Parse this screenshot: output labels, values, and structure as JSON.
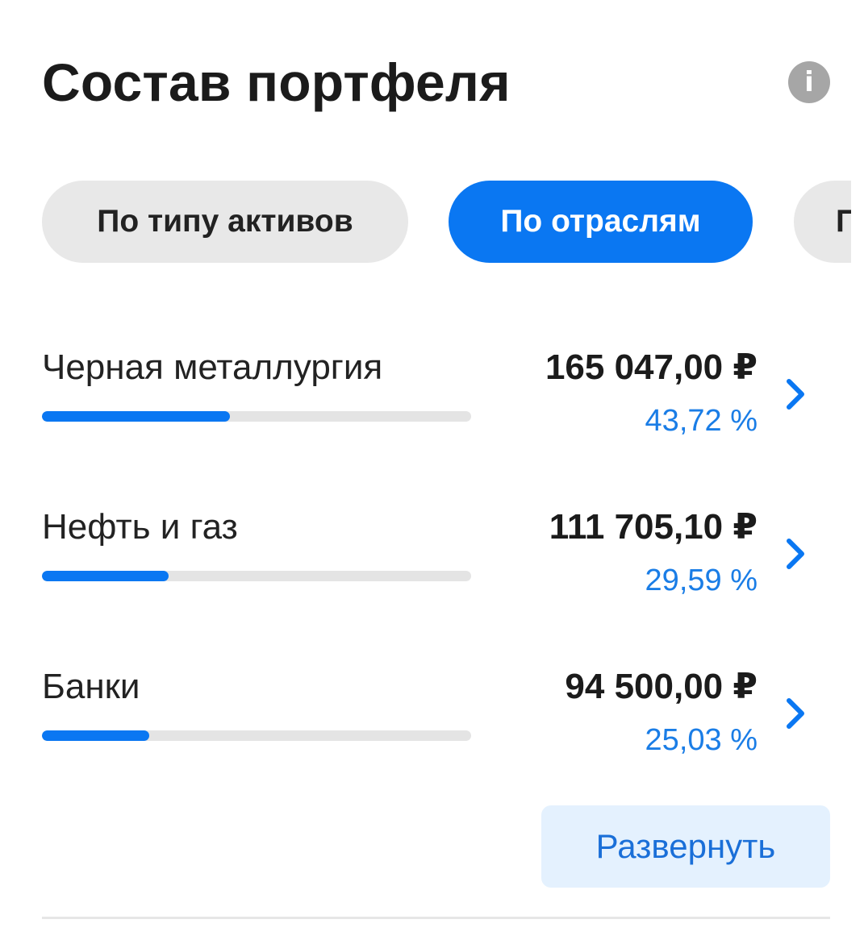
{
  "header": {
    "title": "Состав портфеля",
    "info_icon": "info-icon"
  },
  "tabs": [
    {
      "label": "По типу активов",
      "active": false
    },
    {
      "label": "По отраслям",
      "active": true
    },
    {
      "label": "П",
      "active": false
    }
  ],
  "sectors": [
    {
      "name": "Черная металлургия",
      "amount": "165 047,00 ₽",
      "percent_label": "43,72 %",
      "share": 0.4372,
      "chevron_icon": "chevron-right-icon"
    },
    {
      "name": "Нефть и газ",
      "amount": "111 705,10 ₽",
      "percent_label": "29,59 %",
      "share": 0.2959,
      "chevron_icon": "chevron-right-icon"
    },
    {
      "name": "Банки",
      "amount": "94 500,00 ₽",
      "percent_label": "25,03 %",
      "share": 0.2503,
      "chevron_icon": "chevron-right-icon"
    }
  ],
  "actions": {
    "expand_label": "Развернуть"
  },
  "colors": {
    "accent": "#0a77f2",
    "percent_text": "#1a7de6",
    "chip_inactive": "#e8e8e8",
    "track": "#e4e4e4",
    "expand_bg": "#e4f1fe",
    "info_icon": "#a6a6a6"
  }
}
